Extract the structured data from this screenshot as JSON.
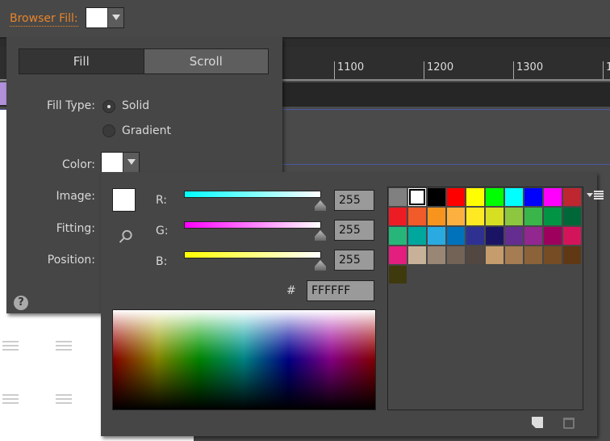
{
  "browser_fill": {
    "label": "Browser Fill:",
    "color": "#FFFFFF"
  },
  "ruler": {
    "labels": [
      "1100",
      "1200",
      "1300",
      "1"
    ]
  },
  "fill_panel": {
    "tabs": [
      {
        "label": "Fill",
        "active": true
      },
      {
        "label": "Scroll",
        "active": false
      }
    ],
    "fill_type_label": "Fill Type:",
    "options": [
      {
        "label": "Solid",
        "selected": true
      },
      {
        "label": "Gradient",
        "selected": false
      }
    ],
    "color_label": "Color:",
    "image_label": "Image:",
    "fitting_label": "Fitting:",
    "position_label": "Position:",
    "help": "?"
  },
  "color_picker": {
    "r_label": "R:",
    "g_label": "G:",
    "b_label": "B:",
    "r": "255",
    "g": "255",
    "b": "255",
    "hash_label": "#",
    "hex": "FFFFFF",
    "swatches": [
      "#808080",
      "#FFFFFF",
      "#000000",
      "#FF0000",
      "#FFFF00",
      "#00FF00",
      "#00FFFF",
      "#0000FF",
      "#FF00FF",
      "#BE2630",
      "#ED1C24",
      "#F15A29",
      "#F7941D",
      "#FBB040",
      "#FFE922",
      "#D7DF23",
      "#8DC63F",
      "#39B54A",
      "#009444",
      "#006838",
      "#27B67A",
      "#00A79D",
      "#29ABE2",
      "#0072BC",
      "#2E3192",
      "#1B1464",
      "#662D91",
      "#92278F",
      "#9E005D",
      "#D4145A",
      "#E21F7E",
      "#C7B299",
      "#998675",
      "#736357",
      "#534741",
      "#C69C6D",
      "#A67C52",
      "#8C6239",
      "#754C24",
      "#603813",
      "#3E3A0E"
    ]
  }
}
